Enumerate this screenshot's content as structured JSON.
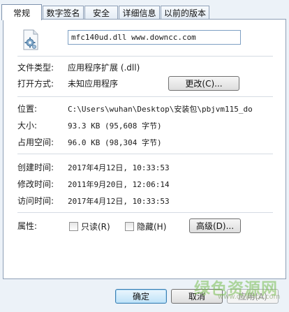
{
  "tabs": [
    {
      "label": "常规",
      "active": true
    },
    {
      "label": "数字签名",
      "active": false
    },
    {
      "label": "安全",
      "active": false
    },
    {
      "label": "详细信息",
      "active": false
    },
    {
      "label": "以前的版本",
      "active": false
    }
  ],
  "file": {
    "icon": "gear-file-icon",
    "name": "mfc140ud.dll  www.downcc.com"
  },
  "fields": {
    "file_type_label": "文件类型:",
    "file_type_value": "应用程序扩展 (.dll)",
    "open_with_label": "打开方式:",
    "open_with_value": "未知应用程序",
    "change_button": "更改(C)...",
    "location_label": "位置:",
    "location_value": "C:\\Users\\wuhan\\Desktop\\安装包\\pbjvm115_do",
    "size_label": "大小:",
    "size_value": "93.3 KB (95,608 字节)",
    "disk_size_label": "占用空间:",
    "disk_size_value": "96.0 KB (98,304 字节)",
    "created_label": "创建时间:",
    "created_value": "2017年4月12日, 10:33:53",
    "modified_label": "修改时间:",
    "modified_value": "2011年9月20日, 12:06:14",
    "accessed_label": "访问时间:",
    "accessed_value": "2017年4月12日, 10:33:53",
    "attributes_label": "属性:",
    "readonly_label": "只读(R)",
    "hidden_label": "隐藏(H)",
    "advanced_button": "高级(D)..."
  },
  "footer": {
    "ok": "确定",
    "cancel": "取消",
    "apply": "应用(A)"
  },
  "watermark": {
    "cn": "绿色资源网",
    "en": "www.downcc.com"
  }
}
